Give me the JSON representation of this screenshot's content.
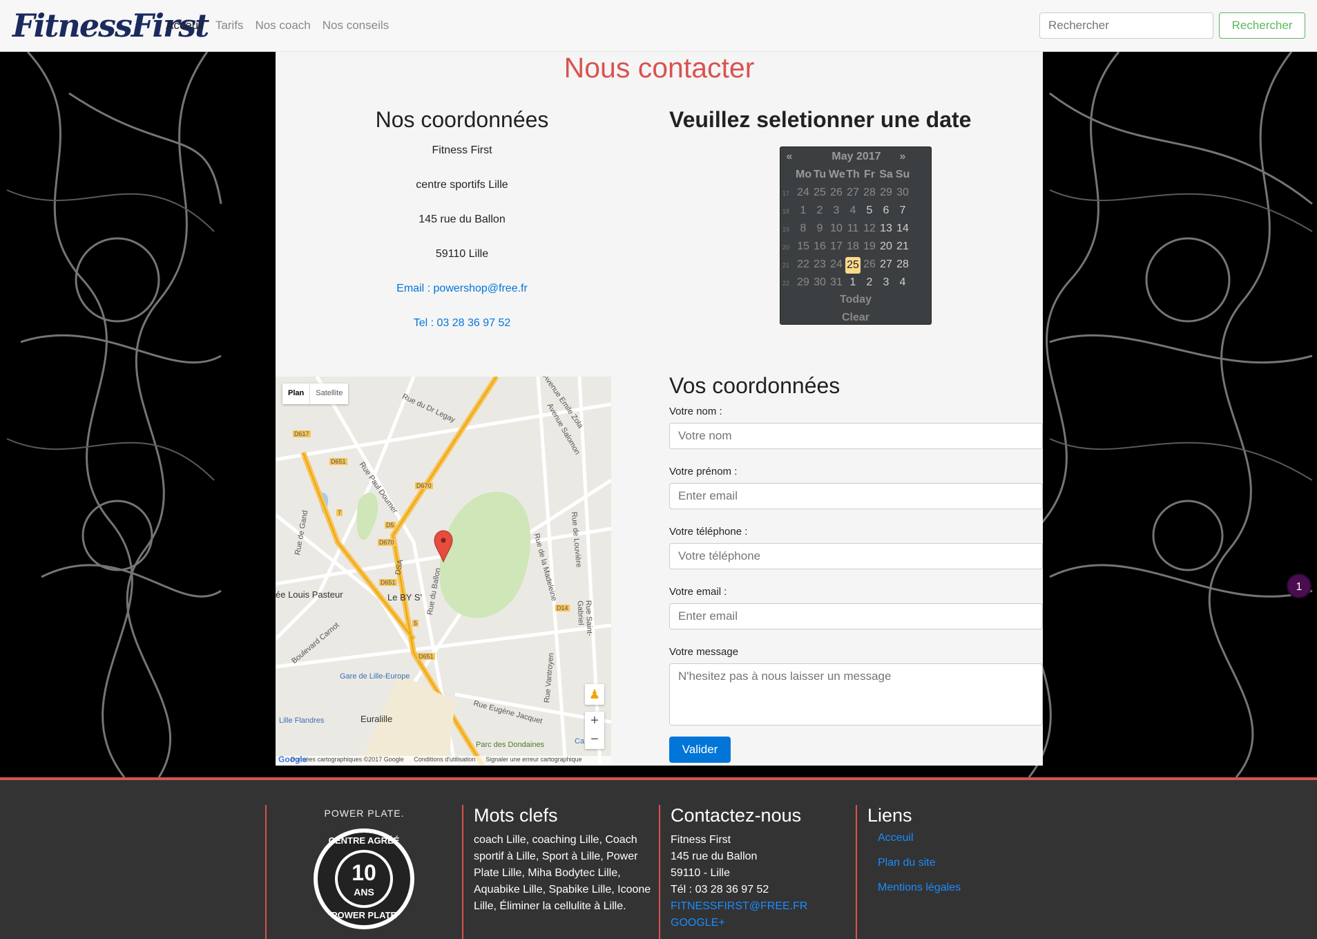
{
  "navbar": {
    "brand": "FitnessFirst",
    "links": [
      {
        "label": "Acceuil",
        "active": true
      },
      {
        "label": "Tarifs",
        "active": false
      },
      {
        "label": "Nos coach",
        "active": false
      },
      {
        "label": "Nos conseils",
        "active": false
      }
    ],
    "search_placeholder": "Rechercher",
    "search_button": "Rechercher"
  },
  "page_title": "Nous contacter",
  "contact": {
    "title": "Nos coordonnées",
    "name": "Fitness First",
    "subtitle": "centre sportifs Lille",
    "street": "145 rue du Ballon",
    "city": "59110 Lille",
    "email": "Email : powershop@free.fr",
    "phone": "Tel : 03 28 36 97 52"
  },
  "date_picker": {
    "title": "Veuillez seletionner une date",
    "prev": "«",
    "next": "»",
    "month": "May 2017",
    "weekdays": [
      "Mo",
      "Tu",
      "We",
      "Th",
      "Fr",
      "Sa",
      "Su"
    ],
    "weeks": [
      {
        "num": "17",
        "days": [
          "24",
          "25",
          "26",
          "27",
          "28",
          "29",
          "30"
        ],
        "muted": [
          true,
          true,
          true,
          true,
          true,
          true,
          true
        ]
      },
      {
        "num": "18",
        "days": [
          "1",
          "2",
          "3",
          "4",
          "5",
          "6",
          "7"
        ],
        "muted": [
          true,
          true,
          true,
          true,
          false,
          false,
          false
        ]
      },
      {
        "num": "19",
        "days": [
          "8",
          "9",
          "10",
          "11",
          "12",
          "13",
          "14"
        ],
        "muted": [
          true,
          true,
          true,
          true,
          true,
          false,
          false
        ]
      },
      {
        "num": "20",
        "days": [
          "15",
          "16",
          "17",
          "18",
          "19",
          "20",
          "21"
        ],
        "muted": [
          true,
          true,
          true,
          true,
          true,
          false,
          false
        ]
      },
      {
        "num": "21",
        "days": [
          "22",
          "23",
          "24",
          "25",
          "26",
          "27",
          "28"
        ],
        "muted": [
          true,
          true,
          true,
          false,
          true,
          false,
          false
        ]
      },
      {
        "num": "22",
        "days": [
          "29",
          "30",
          "31",
          "1",
          "2",
          "3",
          "4"
        ],
        "muted": [
          true,
          true,
          true,
          false,
          false,
          false,
          false
        ]
      }
    ],
    "selected_day": "25",
    "today": "Today",
    "clear": "Clear"
  },
  "map": {
    "plan": "Plan",
    "satellite": "Satellite",
    "labels": [
      "Rue du Dr Legay",
      "Avenue Emile Zola",
      "Avenue Salomon",
      "Rue Paul Doumer",
      "Rue de la Madeleine",
      "Rue de Gand",
      "Rue de Louvière",
      "Le BY S'",
      "ée Louis Pasteur",
      "Rue du Ballon",
      "Rue Saint-Gabriel",
      "Boulevard Carnot",
      "Gare de Lille-Europe",
      "Rue Vantroyen",
      "Rue Eugène Jacquet",
      "Lille Flandres",
      "Euralille",
      "Parc des Dondaines",
      "D617",
      "D651",
      "D670",
      "D5",
      "D670",
      "D651",
      "D14",
      "D651",
      "DSA",
      "7",
      "5",
      "Ca"
    ],
    "footer": [
      "Données cartographiques ©2017 Google",
      "Conditions d'utilisation",
      "Signaler une erreur cartographique"
    ],
    "zoom_in": "+",
    "zoom_out": "−",
    "pegman": "♟",
    "google": "Google"
  },
  "form": {
    "title": "Vos coordonnées",
    "nom_label": "Votre nom :",
    "nom_placeholder": "Votre nom",
    "prenom_label": "Votre prénom :",
    "prenom_placeholder": "Enter email",
    "tel_label": "Votre téléphone :",
    "tel_placeholder": "Votre téléphone",
    "email_label": "Votre email :",
    "email_placeholder": "Enter email",
    "message_label": "Votre message",
    "message_placeholder": "N'hesitez pas à nous laisser un message",
    "submit": "Valider"
  },
  "badge": "1",
  "footer": {
    "logo_top": "POWER PLATE.",
    "logo_ring_top": "CENTRE AGRÉÉ",
    "logo_number": "10",
    "logo_ans": "ANS",
    "logo_ring_bottom": "POWER PLATE",
    "keywords_title": "Mots clefs",
    "keywords": "coach Lille, coaching Lille, Coach sportif à Lille, Sport à Lille, Power Plate Lille, Miha Bodytec Lille, Aquabike Lille, Spabike Lille, Icoone Lille, Éliminer la cellulite à Lille.",
    "contact_title": "Contactez-nous",
    "contact_lines": [
      "Fitness First",
      "145 rue du Ballon",
      "59110 - Lille",
      "Tél : 03 28 36 97 52"
    ],
    "contact_email": "FITNESSFIRST@FREE.FR",
    "contact_google": "GOOGLE+",
    "links_title": "Liens",
    "links": [
      "Acceuil",
      "Plan du site",
      "Mentions légales"
    ]
  },
  "colors": {
    "accent": "#d9534f",
    "link": "#0275d8",
    "success": "#5cb85c",
    "brand": "#1b2a5e"
  }
}
